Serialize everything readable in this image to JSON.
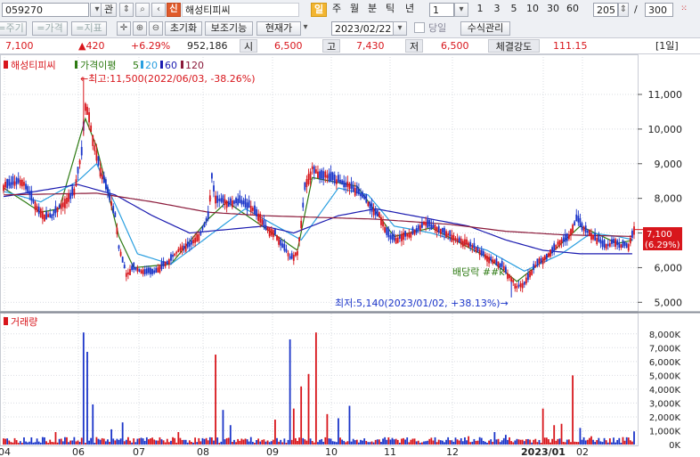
{
  "toolbar": {
    "code": "059270",
    "kwan_label": "관",
    "market_badge": "신",
    "stock_name": "해성티피씨",
    "tabs": [
      "일",
      "주",
      "월",
      "분",
      "틱",
      "년"
    ],
    "active_tab": "일",
    "interval_value": "1",
    "period_buttons": [
      "1",
      "3",
      "5",
      "10",
      "30",
      "60"
    ],
    "count_value": "205",
    "slash": "/",
    "total_value": "300"
  },
  "toolbar2": {
    "b1": "=주기",
    "b2": "=가격",
    "b3": "=지표",
    "reset_label": "초기화",
    "aux_label": "보조기능",
    "price_type_label": "현재가",
    "date_value": "2023/02/22",
    "today_label": "당일",
    "formula_label": "수식관리"
  },
  "quote": {
    "price": "7,100",
    "change": "▲420",
    "change_pct": "+6.29%",
    "volume": "952,186",
    "open_label": "시",
    "open": "6,500",
    "high_label": "고",
    "high": "7,430",
    "low_label": "저",
    "low": "6,500",
    "strength_label": "체결강도",
    "strength": "111.15",
    "period_badge": "[1일]"
  },
  "legend": {
    "name": "해성티피씨",
    "ma_label": "가격이평",
    "ma_periods": [
      "5",
      "20",
      "60",
      "120"
    ]
  },
  "annotations": {
    "high": "←최고:11,500(2022/06/03, -38.26%)",
    "low": "최저:5,140(2023/01/02, +38.13%)→",
    "dividend": "배당락 ##k",
    "price_tag": "7,100",
    "price_tag_pct": "(6.29%)"
  },
  "volume_title": "거래량",
  "colors": {
    "up": "#d8161c",
    "down": "#1b35c9",
    "ma5": "#2d7a12",
    "ma20": "#2a9fe0",
    "ma60": "#1b1bb0",
    "ma120": "#8b1a3a",
    "accent": "#f3b530"
  },
  "chart_data": [
    {
      "type": "candlestick",
      "title": "해성티피씨",
      "x_ticks": [
        "04",
        "06",
        "07",
        "08",
        "09",
        "10",
        "11",
        "12",
        "2023/01",
        "02"
      ],
      "y_ticks": [
        "5,000",
        "6,000",
        "7,000",
        "8,000",
        "9,000",
        "10,000",
        "11,000"
      ],
      "ylim": [
        4700,
        11900
      ],
      "grid": true,
      "close_path": [
        [
          0,
          8350
        ],
        [
          6,
          8450
        ],
        [
          10,
          8500
        ],
        [
          14,
          8150
        ],
        [
          18,
          7700
        ],
        [
          22,
          7500
        ],
        [
          26,
          7500
        ],
        [
          30,
          7750
        ],
        [
          34,
          7950
        ],
        [
          38,
          8250
        ],
        [
          42,
          9300
        ],
        [
          44,
          10700
        ],
        [
          46,
          10400
        ],
        [
          48,
          9700
        ],
        [
          52,
          8800
        ],
        [
          56,
          8200
        ],
        [
          60,
          7500
        ],
        [
          62,
          6600
        ],
        [
          64,
          6200
        ],
        [
          66,
          5800
        ],
        [
          70,
          6000
        ],
        [
          76,
          5850
        ],
        [
          82,
          5900
        ],
        [
          88,
          6150
        ],
        [
          94,
          6500
        ],
        [
          100,
          6650
        ],
        [
          106,
          7000
        ],
        [
          110,
          7500
        ],
        [
          112,
          8600
        ],
        [
          114,
          8000
        ],
        [
          120,
          7850
        ],
        [
          128,
          7900
        ],
        [
          134,
          7700
        ],
        [
          138,
          7450
        ],
        [
          142,
          7100
        ],
        [
          146,
          7000
        ],
        [
          150,
          6650
        ],
        [
          154,
          6300
        ],
        [
          158,
          6400
        ],
        [
          160,
          7300
        ],
        [
          162,
          8300
        ],
        [
          166,
          8900
        ],
        [
          170,
          8700
        ],
        [
          176,
          8600
        ],
        [
          182,
          8450
        ],
        [
          188,
          8300
        ],
        [
          194,
          8000
        ],
        [
          198,
          7700
        ],
        [
          202,
          7500
        ],
        [
          206,
          7000
        ],
        [
          210,
          6800
        ],
        [
          214,
          6900
        ],
        [
          220,
          7000
        ],
        [
          226,
          7300
        ],
        [
          232,
          7150
        ],
        [
          238,
          7000
        ],
        [
          244,
          6800
        ],
        [
          250,
          6700
        ],
        [
          256,
          6450
        ],
        [
          262,
          6250
        ],
        [
          268,
          6050
        ],
        [
          272,
          5750
        ],
        [
          276,
          5450
        ],
        [
          280,
          5550
        ],
        [
          284,
          5900
        ],
        [
          288,
          6200
        ],
        [
          292,
          6300
        ],
        [
          298,
          6700
        ],
        [
          304,
          6900
        ],
        [
          308,
          7400
        ],
        [
          312,
          7100
        ],
        [
          316,
          6950
        ],
        [
          320,
          6800
        ],
        [
          324,
          6600
        ],
        [
          328,
          6750
        ],
        [
          332,
          6650
        ],
        [
          336,
          6650
        ],
        [
          339,
          7100
        ]
      ],
      "ma_series": [
        {
          "name": "5",
          "values": [
            [
              0,
              8300
            ],
            [
              20,
              7600
            ],
            [
              30,
              7700
            ],
            [
              44,
              10300
            ],
            [
              50,
              9500
            ],
            [
              62,
              6900
            ],
            [
              70,
              6000
            ],
            [
              90,
              6100
            ],
            [
              110,
              7400
            ],
            [
              120,
              7900
            ],
            [
              150,
              6800
            ],
            [
              158,
              6500
            ],
            [
              166,
              8600
            ],
            [
              190,
              8350
            ],
            [
              210,
              6900
            ],
            [
              230,
              7150
            ],
            [
              260,
              6300
            ],
            [
              276,
              5600
            ],
            [
              290,
              6200
            ],
            [
              310,
              7200
            ],
            [
              330,
              6700
            ],
            [
              339,
              6800
            ]
          ]
        },
        {
          "name": "20",
          "values": [
            [
              0,
              8200
            ],
            [
              20,
              7900
            ],
            [
              40,
              8500
            ],
            [
              50,
              9000
            ],
            [
              62,
              7600
            ],
            [
              72,
              6400
            ],
            [
              90,
              6100
            ],
            [
              110,
              6900
            ],
            [
              130,
              7700
            ],
            [
              150,
              7100
            ],
            [
              160,
              6800
            ],
            [
              180,
              8300
            ],
            [
              196,
              8100
            ],
            [
              210,
              7200
            ],
            [
              230,
              7000
            ],
            [
              260,
              6500
            ],
            [
              280,
              5900
            ],
            [
              300,
              6400
            ],
            [
              316,
              7000
            ],
            [
              330,
              6900
            ],
            [
              339,
              6800
            ]
          ]
        },
        {
          "name": "60",
          "values": [
            [
              0,
              8050
            ],
            [
              40,
              8400
            ],
            [
              60,
              8100
            ],
            [
              80,
              7500
            ],
            [
              100,
              7000
            ],
            [
              120,
              7100
            ],
            [
              140,
              7200
            ],
            [
              156,
              7000
            ],
            [
              180,
              7500
            ],
            [
              200,
              7700
            ],
            [
              220,
              7500
            ],
            [
              250,
              7200
            ],
            [
              270,
              6800
            ],
            [
              290,
              6500
            ],
            [
              310,
              6400
            ],
            [
              339,
              6400
            ]
          ]
        },
        {
          "name": "120",
          "values": [
            [
              0,
              8100
            ],
            [
              50,
              8150
            ],
            [
              80,
              7900
            ],
            [
              110,
              7600
            ],
            [
              140,
              7500
            ],
            [
              170,
              7450
            ],
            [
              200,
              7400
            ],
            [
              240,
              7250
            ],
            [
              270,
              7050
            ],
            [
              300,
              6950
            ],
            [
              339,
              6900
            ]
          ]
        }
      ],
      "current_price": 7100
    },
    {
      "type": "bar",
      "title": "거래량",
      "y_ticks": [
        "0K",
        "1,000K",
        "2,000K",
        "3,000K",
        "4,000K",
        "5,000K",
        "6,000K",
        "7,000K",
        "8,000K"
      ],
      "ylim": [
        0,
        8500
      ],
      "spikes": [
        [
          28,
          900
        ],
        [
          43,
          8100
        ],
        [
          45,
          6700
        ],
        [
          48,
          2900
        ],
        [
          58,
          1100
        ],
        [
          64,
          1600
        ],
        [
          80,
          500
        ],
        [
          94,
          900
        ],
        [
          114,
          6500
        ],
        [
          118,
          2500
        ],
        [
          122,
          1400
        ],
        [
          146,
          1800
        ],
        [
          154,
          7600
        ],
        [
          156,
          2600
        ],
        [
          160,
          4200
        ],
        [
          164,
          5100
        ],
        [
          168,
          8100
        ],
        [
          174,
          2200
        ],
        [
          180,
          1900
        ],
        [
          186,
          2800
        ],
        [
          250,
          600
        ],
        [
          264,
          900
        ],
        [
          270,
          700
        ],
        [
          276,
          400
        ],
        [
          290,
          2600
        ],
        [
          296,
          1400
        ],
        [
          300,
          1500
        ],
        [
          306,
          5000
        ],
        [
          310,
          1200
        ],
        [
          316,
          600
        ],
        [
          328,
          500
        ],
        [
          339,
          950
        ]
      ]
    }
  ]
}
